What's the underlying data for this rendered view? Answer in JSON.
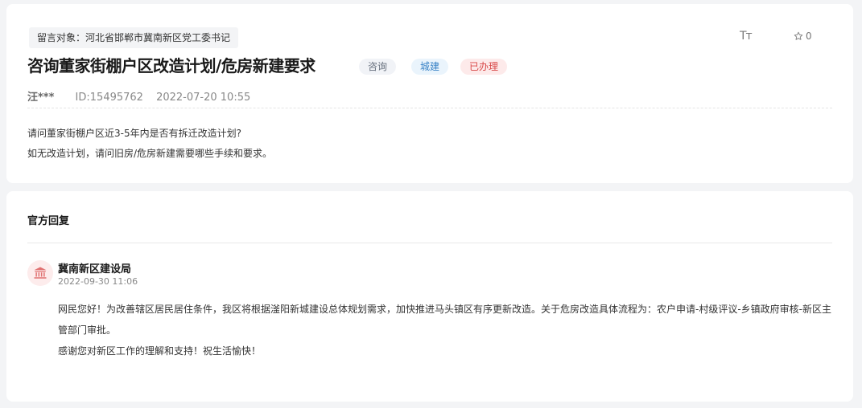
{
  "message": {
    "target": "留言对象：河北省邯郸市冀南新区党工委书记",
    "title": "咨询董家街棚户区改造计划/危房新建要求",
    "tags": [
      "咨询",
      "城建",
      "已办理"
    ],
    "font_toggle": "Tт",
    "favorite_count": "0",
    "author": "汪***",
    "id": "ID:15495762",
    "date": "2022-07-20 10:55",
    "body_lines": [
      "请问董家街棚户区近3-5年内是否有拆迁改造计划?",
      "如无改造计划，请问旧房/危房新建需要哪些手续和要求。"
    ]
  },
  "reply": {
    "heading": "官方回复",
    "org": "冀南新区建设局",
    "time": "2022-09-30 11:06",
    "lines": [
      "网民您好！为改善辖区居民居住条件，我区将根据滏阳新城建设总体规划需求，加快推进马头镇区有序更新改造。关于危房改造具体流程为：农户申请-村级评议-乡镇政府审核-新区主管部门审批。",
      "感谢您对新区工作的理解和支持！祝生活愉快！"
    ]
  },
  "colors": {
    "page_bg": "#f3f4f6",
    "card_bg": "#ffffff",
    "done_tag": "#d84848",
    "urban_tag": "#3a83c6",
    "org_icon": "#e07070"
  },
  "icons": {
    "font": "font-size-icon",
    "favorite": "star-outline-icon",
    "org": "government-building-icon"
  }
}
